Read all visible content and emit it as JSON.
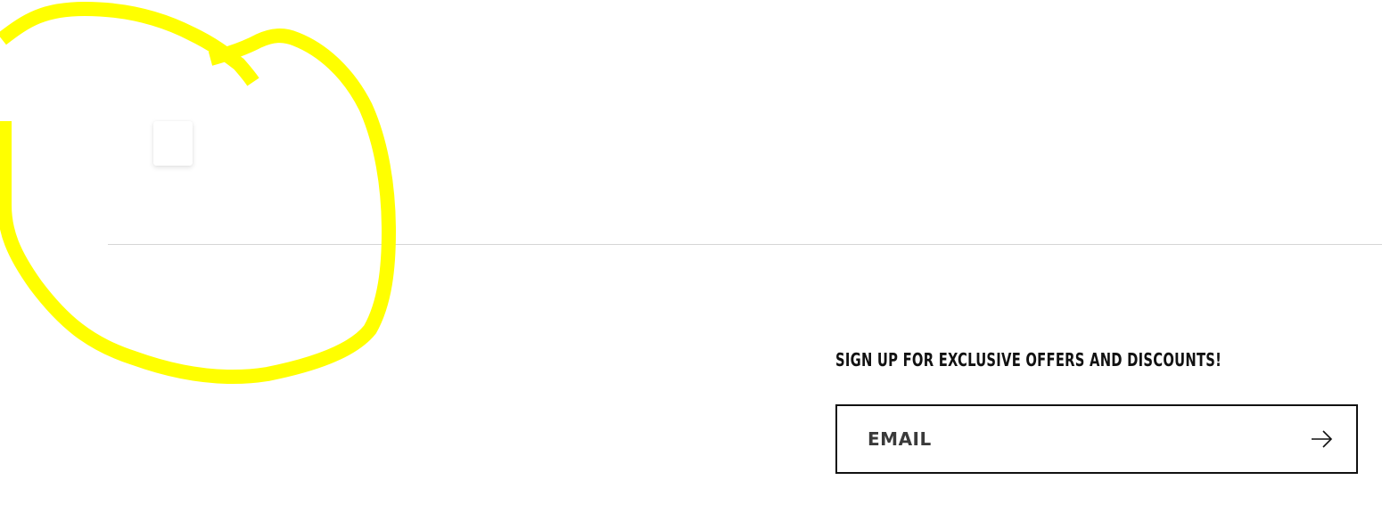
{
  "newsletter": {
    "heading": "SIGN UP FOR EXCLUSIVE OFFERS AND DISCOUNTS!",
    "email_placeholder": "EMAIL",
    "submit_icon": "arrow-right-icon"
  },
  "colors": {
    "annotation": "#ffff00",
    "text": "#111111",
    "border": "#111111",
    "divider": "#d6d6d6"
  }
}
